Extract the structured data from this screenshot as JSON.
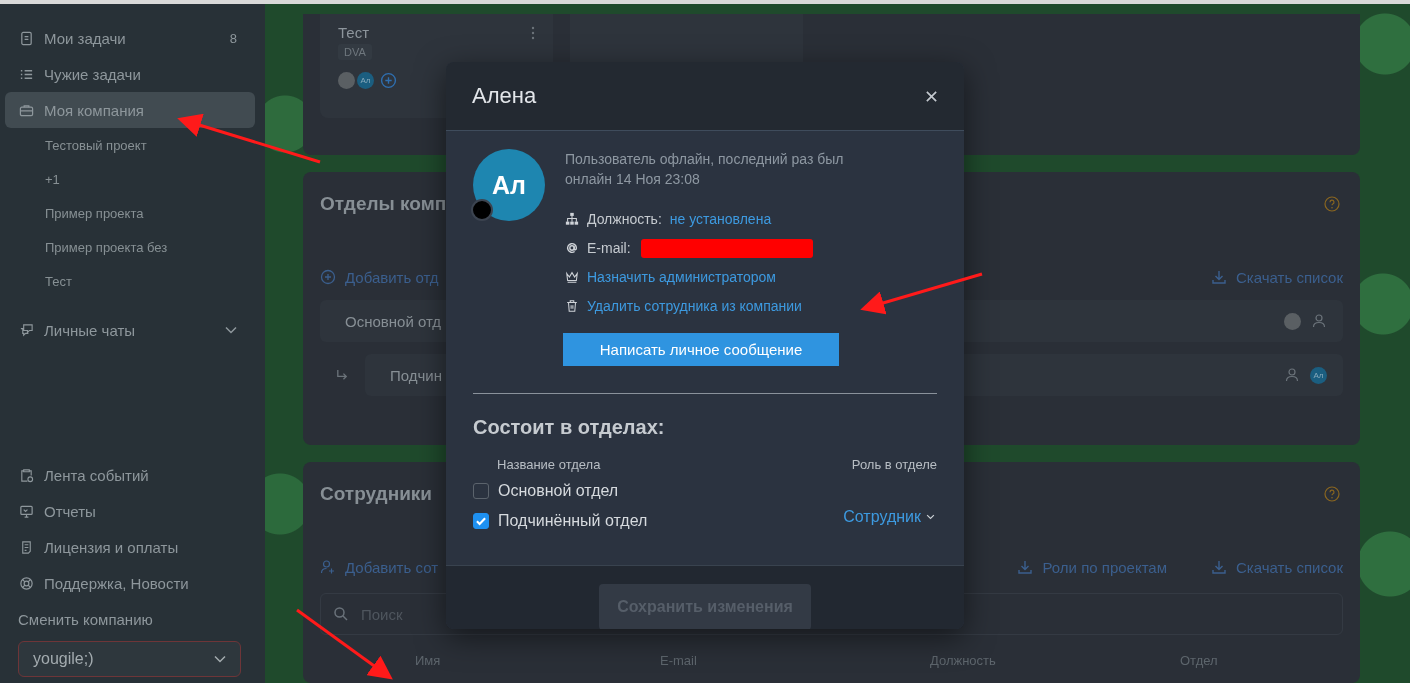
{
  "sidebar": {
    "items": [
      {
        "label": "Мои задачи",
        "count": "8",
        "selected": false
      },
      {
        "label": "Чужие задачи",
        "selected": false
      },
      {
        "label": "Моя компания",
        "selected": true
      }
    ],
    "projects": [
      "Тестовый проект",
      "+1",
      "Пример проекта",
      "Пример проекта без",
      "Тест"
    ],
    "chats": {
      "label": "Личные чаты",
      "expanded": false
    },
    "bottom_items": [
      "Лента событий",
      "Отчеты",
      "Лицензия и оплаты",
      "Поддержка, Новости"
    ],
    "company_switch": {
      "label": "Сменить компанию",
      "value": "yougile;)"
    }
  },
  "board": {
    "task": {
      "title": "Тест",
      "tag": "DVA",
      "members": [
        {
          "kind": "photo"
        },
        {
          "kind": "initials",
          "initials": "Ал"
        }
      ]
    }
  },
  "departments": {
    "title": "Отделы комп",
    "add_link": "Добавить отд",
    "download_link": "Скачать список",
    "tree": [
      {
        "name": "Основной отд",
        "members": [
          {
            "kind": "photo"
          },
          {
            "kind": "empty"
          }
        ],
        "children": [
          {
            "name": "Подчин",
            "members": [
              {
                "kind": "empty"
              },
              {
                "kind": "initials",
                "initials": "Ал"
              }
            ]
          }
        ]
      }
    ]
  },
  "employees": {
    "title": "Сотрудники",
    "add_link": "Добавить сот",
    "links": [
      "Роли по проектам",
      "Скачать список"
    ],
    "search": {
      "placeholder": "Поиск"
    },
    "columns": [
      "Имя",
      "E-mail",
      "Должность",
      "Отдел"
    ]
  },
  "modal": {
    "title": "Алена",
    "avatar_initials": "Ал",
    "online": false,
    "status_text": "Пользователь офлайн, последний раз был онлайн 14 Ноя 23:08",
    "position_label": "Должность:",
    "position_value": "не установлена",
    "email_label": "E-mail:",
    "email_redacted": true,
    "actions": [
      "Назначить администратором",
      "Удалить сотрудника из компании"
    ],
    "message_button": "Написать личное сообщение",
    "departments_title": "Состоит в отделах:",
    "columns": [
      "Название отдела",
      "Роль в отделе"
    ],
    "departments": [
      {
        "name": "Основной отдел",
        "checked": false
      },
      {
        "name": "Подчинённый отдел",
        "checked": true,
        "role": "Сотрудник"
      }
    ],
    "save_button": {
      "label": "Сохранить изменения",
      "disabled": true
    }
  }
}
